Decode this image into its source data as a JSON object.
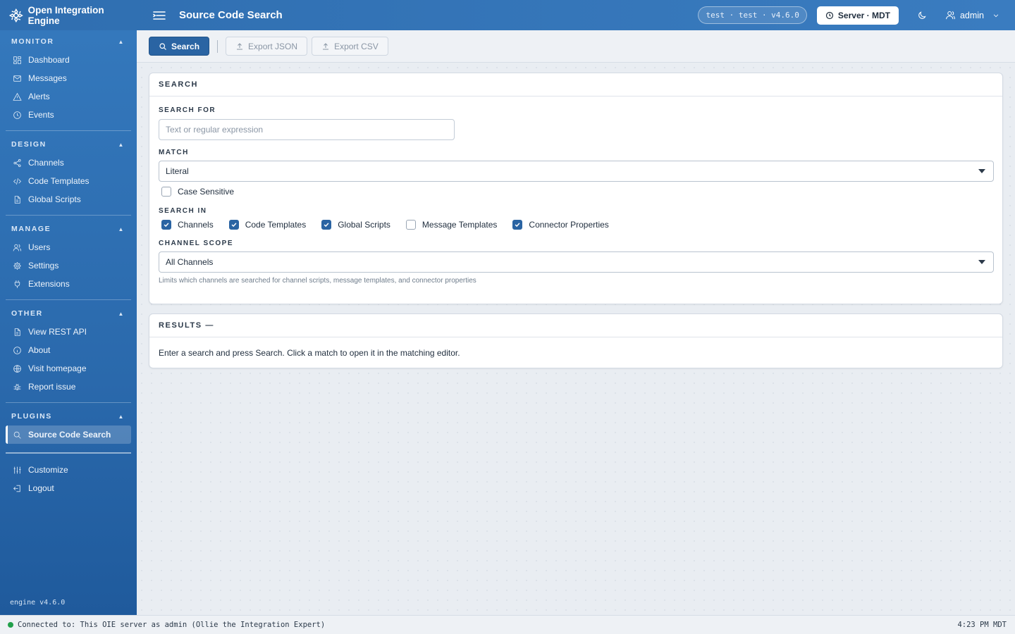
{
  "app": {
    "title": "Open Integration Engine",
    "page_title": "Source Code Search"
  },
  "header": {
    "env": "test · test · v4.6.0",
    "server_button": "Server · MDT",
    "user": "admin"
  },
  "sidebar": {
    "sections": [
      {
        "title": "MONITOR",
        "items": [
          "Dashboard",
          "Messages",
          "Alerts",
          "Events"
        ]
      },
      {
        "title": "DESIGN",
        "items": [
          "Channels",
          "Code Templates",
          "Global Scripts"
        ]
      },
      {
        "title": "MANAGE",
        "items": [
          "Users",
          "Settings",
          "Extensions"
        ]
      },
      {
        "title": "OTHER",
        "items": [
          "View REST API",
          "About",
          "Visit homepage",
          "Report issue"
        ]
      },
      {
        "title": "PLUGINS",
        "items": [
          "Source Code Search"
        ]
      }
    ],
    "footer_items": [
      "Customize",
      "Logout"
    ],
    "version": "engine v4.6.0"
  },
  "toolbar": {
    "search": "Search",
    "export_json": "Export JSON",
    "export_csv": "Export CSV"
  },
  "search_card": {
    "title": "SEARCH",
    "search_for_label": "SEARCH FOR",
    "search_placeholder": "Text or regular expression",
    "match_label": "MATCH",
    "match_value": "Literal",
    "case_sensitive": {
      "label": "Case Sensitive",
      "checked": false
    },
    "search_in_label": "SEARCH IN",
    "search_in": [
      {
        "label": "Channels",
        "checked": true
      },
      {
        "label": "Code Templates",
        "checked": true
      },
      {
        "label": "Global Scripts",
        "checked": true
      },
      {
        "label": "Message Templates",
        "checked": false
      },
      {
        "label": "Connector Properties",
        "checked": true
      }
    ],
    "scope_label": "CHANNEL SCOPE",
    "scope_value": "All Channels",
    "scope_hint": "Limits which channels are searched for channel scripts, message templates, and connector properties"
  },
  "results_card": {
    "title": "RESULTS —",
    "empty_text": "Enter a search and press Search. Click a match to open it in the matching editor."
  },
  "status": {
    "connection": "Connected to: This OIE server as admin (Ollie the Integration Expert)",
    "time": "4:23 PM MDT",
    "indicator_color": "#22a04b"
  },
  "colors": {
    "brand": "#3478bc",
    "primary": "#2a64a3"
  }
}
